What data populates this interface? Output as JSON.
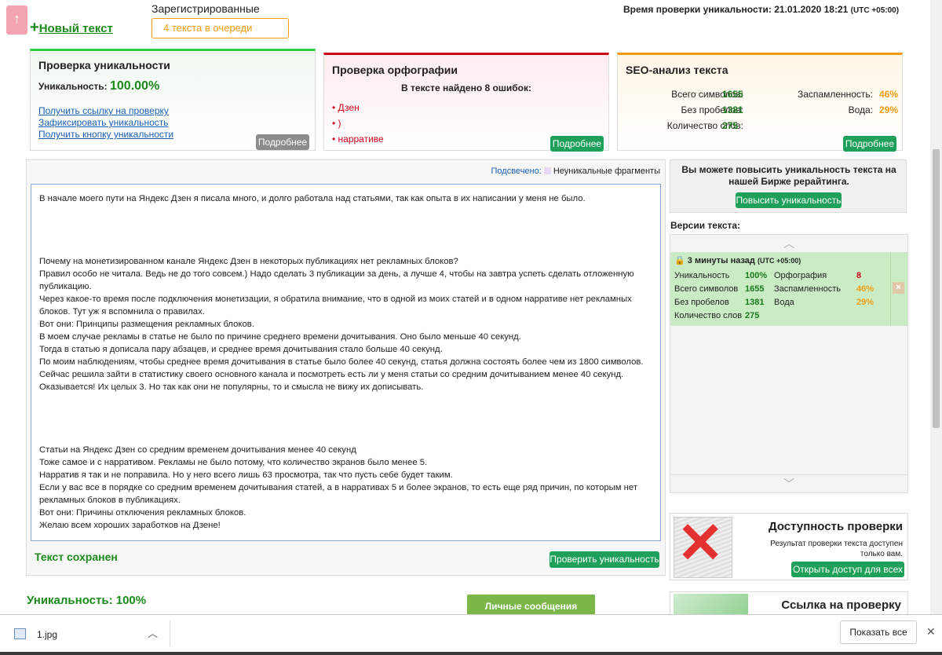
{
  "top": {
    "up_arrow": "↑",
    "new_text": "Новый текст",
    "registered": "Зарегистрированные",
    "queue": "4 текста в очереди",
    "check_time_label": "Время проверки уникальности: 21.01.2020 18:21",
    "tz": "(UTC +05:00)"
  },
  "uniq": {
    "title": "Проверка уникальности",
    "label": "Уникальность:",
    "value": "100.00%",
    "links": [
      "Получить ссылку на проверку",
      "Зафиксировать уникальность",
      "Получить кнопку уникальности"
    ],
    "more": "Подробнее"
  },
  "spell": {
    "title": "Проверка орфографии",
    "found": "В тексте найдено 8 ошибок:",
    "errors": [
      "• Дзен",
      "• )",
      "• нарративе"
    ],
    "more": "Подробнее"
  },
  "seo": {
    "title": "SEO-анализ текста",
    "rows": [
      {
        "l": "Всего символов:",
        "v": "1655"
      },
      {
        "l": "Без пробелов:",
        "v": "1381"
      },
      {
        "l": "Количество слов:",
        "v": "275"
      }
    ],
    "rows2": [
      {
        "l": "Заспамленность:",
        "v": "46%"
      },
      {
        "l": "Вода:",
        "v": "29%"
      }
    ],
    "more": "Подробнее"
  },
  "editor": {
    "highlight_label": "Подсвечено:",
    "legend": "Неуникальные фрагменты",
    "saved": "Текст сохранен",
    "check_btn": "Проверить уникальность",
    "lines": [
      "В начале моего пути на Яндекс Дзен я писала много, и долго работала над статьями, так как опыта в их написании у меня не было.",
      "",
      "",
      "",
      "",
      "Почему на монетизированном канале Яндекс Дзен в некоторых публикациях нет рекламных блоков?",
      "Правил особо не читала. Ведь не до того совсем.) Надо сделать 3 публикации за день, а лучше 4, чтобы на завтра успеть сделать отложенную",
      "публикацию.",
      "Через какое-то время после подключения монетизации, я обратила внимание, что в одной из моих статей и в одном нарративе нет рекламных",
      "блоков. Тут уж я вспомнила о правилах.",
      "Вот они: Принципы размещения рекламных блоков.",
      "В моем случае рекламы в статье не было по причине среднего времени дочитывания. Оно было меньше 40 секунд.",
      "Тогда в статью я дописала пару абзацев, и среднее время дочитывания стало больше 40 секунд.",
      "По моим наблюдениям, чтобы среднее время дочитывания в статье было более 40 секунд, статья должна состоять более чем из 1800 символов.",
      "Сейчас решила зайти в статистику своего основного канала и посмотреть есть ли у меня статьи со средним дочитыванием менее 40 секунд.",
      "Оказывается! Их целых 3. Но так как они не популярны, то и смысла не вижу их дописывать.",
      "",
      "",
      "",
      "",
      "Статьи на Яндекс Дзен со средним временем дочитывания менее 40 секунд",
      "Тоже самое и с нарративом. Рекламы не было потому, что количество экранов было менее 5.",
      "Нарратив я так и не поправила. Но у него всего лишь 63 просмотра, так что пусть себе будет таким.",
      "Если у вас все в порядке со средним временем дочитывания статей, а в нарративах 5 и более экранов, то есть еще ряд причин, по которым нет",
      "рекламных блоков в публикациях.",
      "Вот они: Причины отключения рекламных блоков.",
      "Желаю всем хороших заработков на Дзене!"
    ]
  },
  "side": {
    "promo": "Вы можете повысить уникальность текста на нашей Бирже рерайтинга.",
    "promo_btn": "Повысить уникальность",
    "versions_title": "Версии текста:",
    "version_time": "3 минуты назад",
    "version_tz": "(UTC +05:00)",
    "v_left": [
      {
        "l": "Уникальность",
        "v": "100%"
      },
      {
        "l": "Всего символов",
        "v": "1655"
      },
      {
        "l": "Без пробелов",
        "v": "1381"
      },
      {
        "l": "Количество слов",
        "v": "275"
      }
    ],
    "v_right": [
      {
        "l": "Орфография",
        "v": "8"
      },
      {
        "l": "Заспамленность",
        "v": "46%"
      },
      {
        "l": "Вода",
        "v": "29%"
      }
    ],
    "access_title": "Доступность проверки",
    "access_text": "Результат проверки текста доступен только вам.",
    "access_btn": "Открыть доступ для всех",
    "link_title": "Ссылка на проверку"
  },
  "bottom": {
    "uniq": "Уникальность: 100%",
    "messages": "Личные сообщения"
  },
  "download": {
    "file": "1.jpg",
    "show_all": "Показать все"
  }
}
